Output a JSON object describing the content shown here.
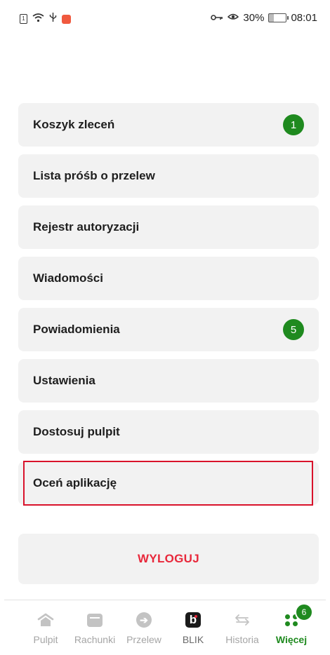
{
  "status_bar": {
    "battery": "30%",
    "time": "08:01"
  },
  "menu": {
    "items": [
      {
        "label": "Koszyk zleceń",
        "badge": "1"
      },
      {
        "label": "Lista próśb o przelew",
        "badge": null
      },
      {
        "label": "Rejestr autoryzacji",
        "badge": null
      },
      {
        "label": "Wiadomości",
        "badge": null
      },
      {
        "label": "Powiadomienia",
        "badge": "5"
      },
      {
        "label": "Ustawienia",
        "badge": null
      },
      {
        "label": "Dostosuj pulpit",
        "badge": null
      },
      {
        "label": "Oceń aplikację",
        "badge": null
      }
    ],
    "logout_label": "WYLOGUJ"
  },
  "bottom_nav": {
    "tabs": [
      {
        "label": "Pulpit",
        "icon": "home-icon"
      },
      {
        "label": "Rachunki",
        "icon": "wallet-icon"
      },
      {
        "label": "Przelew",
        "icon": "arrow-right-circle-icon"
      },
      {
        "label": "BLIK",
        "icon": "blik-icon"
      },
      {
        "label": "Historia",
        "icon": "swap-arrows-icon"
      },
      {
        "label": "Więcej",
        "icon": "more-dots-icon",
        "badge": "6",
        "active": true
      }
    ]
  },
  "colors": {
    "accent": "#1f8a1f",
    "logout_text": "#e8283b",
    "highlight": "#d9122b",
    "item_bg": "#f2f2f2"
  }
}
